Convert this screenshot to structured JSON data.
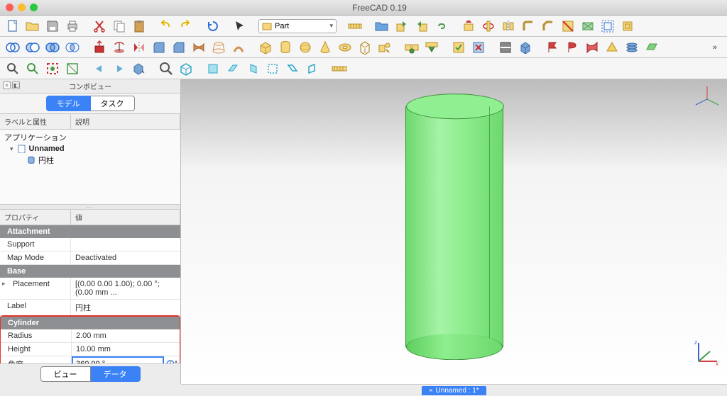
{
  "app": {
    "title": "FreeCAD 0.19"
  },
  "workbench": {
    "selected": "Part"
  },
  "panel": {
    "title": "コンボビュー",
    "top_tabs": {
      "model": "モデル",
      "task": "タスク"
    },
    "tree_headers": {
      "label": "ラベルと属性",
      "desc": "説明"
    },
    "tree": {
      "root": "アプリケーション",
      "doc": "Unnamed",
      "item": "円柱"
    },
    "prop_headers": {
      "prop": "プロパティ",
      "val": "値"
    },
    "groups": {
      "attachment": "Attachment",
      "base": "Base",
      "cylinder": "Cylinder"
    },
    "props": {
      "support": {
        "k": "Support",
        "v": ""
      },
      "mapmode": {
        "k": "Map Mode",
        "v": "Deactivated"
      },
      "placement": {
        "k": "Placement",
        "v": "[(0.00 0.00 1.00); 0.00 °; (0.00 mm ..."
      },
      "label": {
        "k": "Label",
        "v": "円柱"
      },
      "radius": {
        "k": "Radius",
        "v": "2.00 mm"
      },
      "height": {
        "k": "Height",
        "v": "10.00 mm"
      },
      "angle": {
        "k": "角度",
        "v": "360.00 °"
      }
    },
    "bottom_tabs": {
      "view": "ビュー",
      "data": "データ"
    }
  },
  "status": {
    "doc": "Unnamed : 1*"
  },
  "icons": {
    "new": "new",
    "open": "open",
    "save": "save",
    "print": "print",
    "cut": "cut",
    "copy": "copy",
    "paste": "paste",
    "undo": "undo",
    "redo": "redo",
    "refresh": "refresh",
    "pointer": "pointer",
    "measure": "measure",
    "folder": "folder",
    "export": "export",
    "import": "import",
    "link": "link",
    "boolean_union": "union",
    "boolean_cut": "cut",
    "boolean_common": "common",
    "box": "box",
    "cylinder": "cyl",
    "sphere": "sphere",
    "cone": "cone",
    "torus": "torus",
    "prism": "prism",
    "sweep": "sweep",
    "mirror": "mirror",
    "fillet": "fillet",
    "chamfer": "chamfer",
    "zoom_fit": "fit",
    "zoom_sel": "sel",
    "zoom_in": "in",
    "zoom_out": "out",
    "left": "left",
    "right": "right",
    "view_cfg": "vcfg",
    "iso": "iso",
    "front": "front",
    "top": "top",
    "side": "side",
    "back": "back",
    "bottom": "bot",
    "ruler": "ruler"
  }
}
